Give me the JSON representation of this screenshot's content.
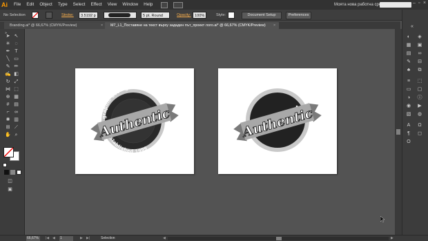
{
  "app": {
    "logo": "Ai"
  },
  "menu": [
    "File",
    "Edit",
    "Object",
    "Type",
    "Select",
    "Effect",
    "View",
    "Window",
    "Help"
  ],
  "workspace": "Моята нова работна среда",
  "control": {
    "selection": "No Selection",
    "stroke_label": "Stroke:",
    "stroke_value": "3.5192 p",
    "brush": "5 pt. Round",
    "opacity_label": "Opacity:",
    "opacity_value": "100%",
    "style_label": "Style:",
    "doc_setup": "Document Setup",
    "preferences": "Preferences"
  },
  "tabs": [
    {
      "label": "Branding.ai* @ 66,67% (CMYK/Preview)",
      "active": false
    },
    {
      "label": "M7_L1_Поставяне на текст върху зададен път_проект лого.ai* @ 66,67% (CMYK/Preview)",
      "active": true
    }
  ],
  "logos": [
    {
      "ring_text_top": "graphic desing studio",
      "banner": "Authentic",
      "ring_text_bottom": "established 1999",
      "fill": "#222222"
    },
    {
      "banner": "Authentic",
      "fill": "#222222"
    }
  ],
  "status": {
    "zoom": "66,67%",
    "page": "1",
    "mode": "Selection"
  },
  "colors": {
    "accent": "#ff9a00",
    "ring": "#c9c9c9",
    "banner": "#a8a8a8"
  }
}
